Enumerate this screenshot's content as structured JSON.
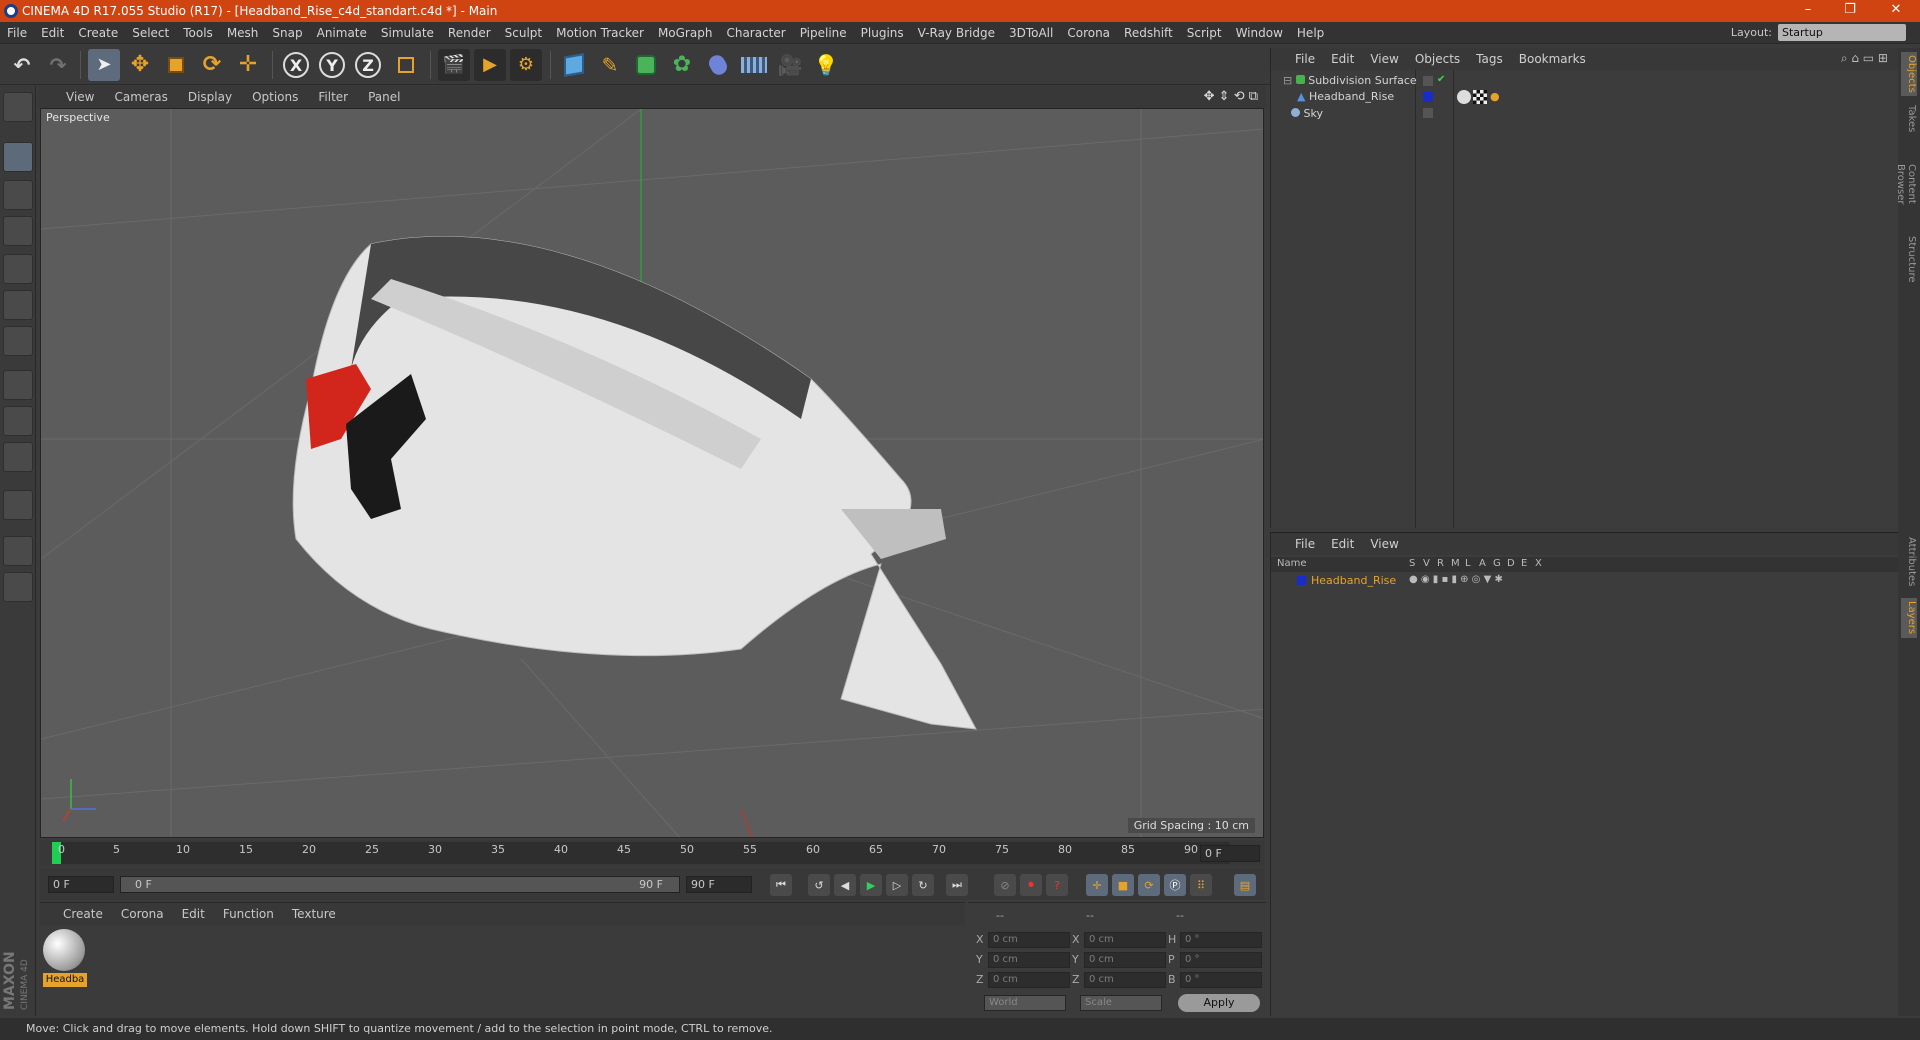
{
  "window": {
    "title": "CINEMA 4D R17.055 Studio (R17) - [Headband_Rise_c4d_standart.c4d *] - Main",
    "min": "–",
    "max": "❐",
    "close": "✕"
  },
  "menu": [
    "File",
    "Edit",
    "Create",
    "Select",
    "Tools",
    "Mesh",
    "Snap",
    "Animate",
    "Simulate",
    "Render",
    "Sculpt",
    "Motion Tracker",
    "MoGraph",
    "Character",
    "Pipeline",
    "Plugins",
    "V-Ray Bridge",
    "3DToAll",
    "Corona",
    "Redshift",
    "Script",
    "Window",
    "Help"
  ],
  "layout": {
    "label": "Layout:",
    "value": "Startup"
  },
  "toolbar": {
    "x": "X",
    "y": "Y",
    "z": "Z"
  },
  "viewport": {
    "menu": [
      "View",
      "Cameras",
      "Display",
      "Options",
      "Filter",
      "Panel"
    ],
    "label": "Perspective",
    "grid_spacing": "Grid Spacing : 10 cm"
  },
  "timeline": {
    "ticks": [
      "0",
      "5",
      "10",
      "15",
      "20",
      "25",
      "30",
      "35",
      "40",
      "45",
      "50",
      "55",
      "60",
      "65",
      "70",
      "75",
      "80",
      "85",
      "90"
    ],
    "current_frame": "0 F",
    "start": "0 F",
    "range_start": "0 F",
    "range_end": "90 F",
    "end": "90 F"
  },
  "material_manager": {
    "menu": [
      "Create",
      "Corona",
      "Edit",
      "Function",
      "Texture"
    ],
    "material_name": "Headba"
  },
  "coords": {
    "header": [
      "--",
      "--",
      "--"
    ],
    "rows": [
      {
        "a": "X",
        "av": "0 cm",
        "b": "X",
        "bv": "0 cm",
        "c": "H",
        "cv": "0 °"
      },
      {
        "a": "Y",
        "av": "0 cm",
        "b": "Y",
        "bv": "0 cm",
        "c": "P",
        "cv": "0 °"
      },
      {
        "a": "Z",
        "av": "0 cm",
        "b": "Z",
        "bv": "0 cm",
        "c": "B",
        "cv": "0 °"
      }
    ],
    "world": "World",
    "scale": "Scale",
    "apply": "Apply"
  },
  "objects": {
    "menu": [
      "File",
      "Edit",
      "View",
      "Objects",
      "Tags",
      "Bookmarks"
    ],
    "items": [
      {
        "name": "Subdivision Surface",
        "color": "#45b34a"
      },
      {
        "name": "Headband_Rise",
        "color": "#5b8fd9"
      },
      {
        "name": "Sky",
        "color": "#8fb0d6"
      }
    ]
  },
  "layers": {
    "menu": [
      "File",
      "Edit",
      "View"
    ],
    "name_header": "Name",
    "cols": [
      "S",
      "V",
      "R",
      "M",
      "L",
      "A",
      "G",
      "D",
      "E",
      "X"
    ],
    "row": "Headband_Rise",
    "row_color": "#e5a32b"
  },
  "side_tabs": [
    "Objects",
    "Takes",
    "Content Browser",
    "Structure",
    "Attributes",
    "Layers"
  ],
  "branding": {
    "maxon": "MAXON",
    "c4d": "CINEMA 4D"
  },
  "status": "Move: Click and drag to move elements. Hold down SHIFT to quantize movement / add to the selection in point mode, CTRL to remove."
}
